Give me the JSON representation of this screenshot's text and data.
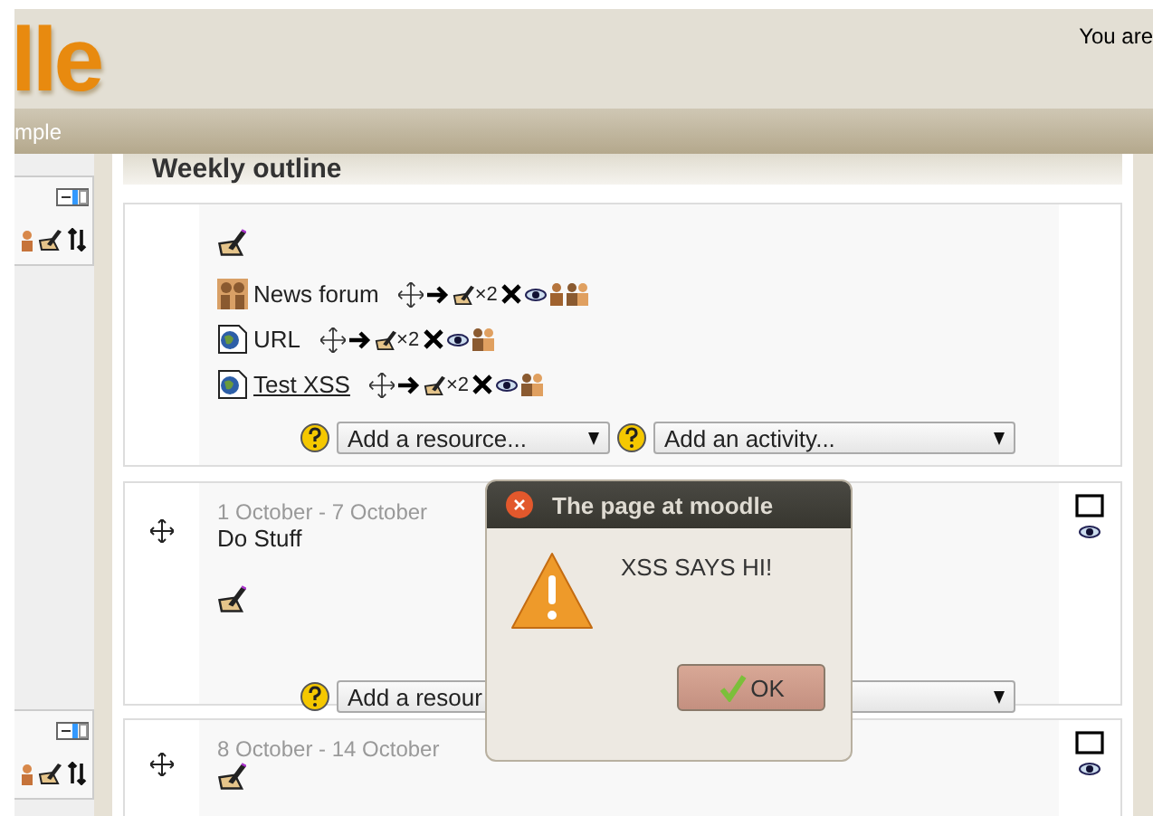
{
  "header": {
    "logo": "lle",
    "login_text": "You are"
  },
  "navbar": {
    "breadcrumb": "mple"
  },
  "sidebar": {
    "blocks": [
      {
        "kind": "block"
      },
      {
        "kind": "block"
      }
    ]
  },
  "main": {
    "heading": "Weekly outline",
    "sections": [
      {
        "kind": "general",
        "items": [
          {
            "kind": "forum",
            "name": "News forum",
            "underlined": false,
            "duplicate_label": "×2",
            "person_icon": true
          },
          {
            "kind": "url",
            "name": "URL",
            "underlined": false,
            "duplicate_label": "×2",
            "person_icon": false
          },
          {
            "kind": "url",
            "name": " Test XSS",
            "underlined": true,
            "duplicate_label": "×2",
            "person_icon": false
          }
        ],
        "resource_select": "Add a resource...",
        "activity_select": "Add an activity..."
      },
      {
        "kind": "week",
        "dates": "1 October - 7 October",
        "summary": "Do Stuff",
        "resource_select": "Add a resour"
      },
      {
        "kind": "week",
        "dates": "8 October - 14 October"
      }
    ]
  },
  "dialog": {
    "title": "The page at moodle",
    "message": "XSS SAYS HI!",
    "button": "OK"
  }
}
